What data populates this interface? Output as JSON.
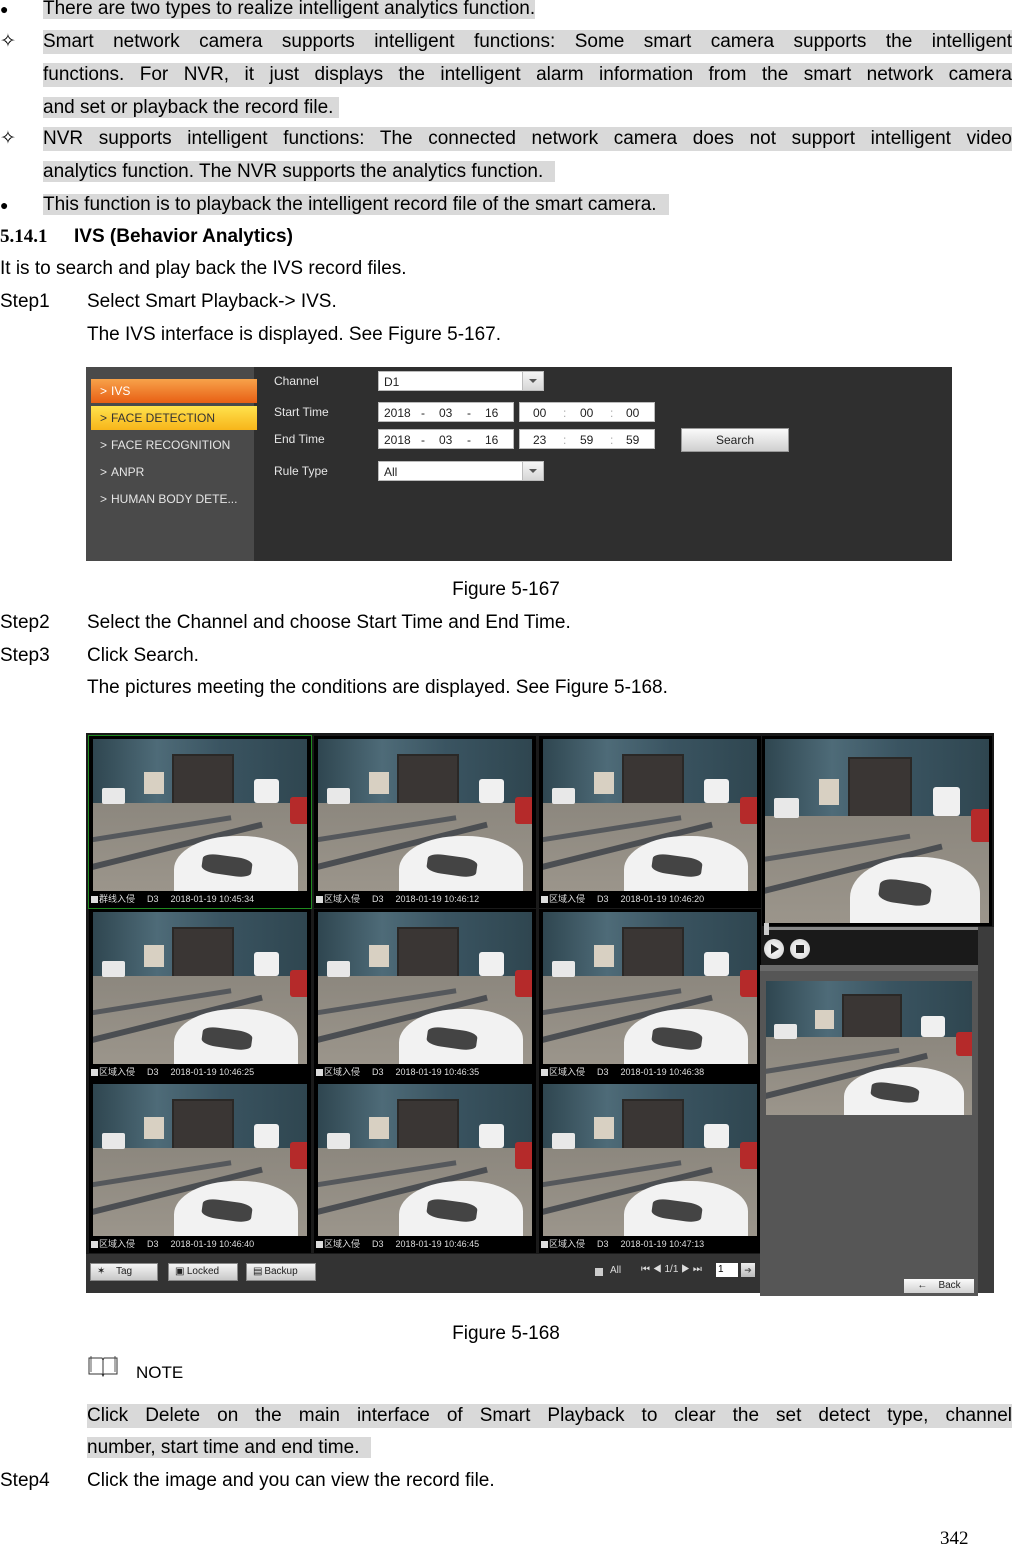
{
  "bullets": [
    {
      "icon": "filled-bullet-icon",
      "glyph": "●",
      "text": "There are two types to realize intelligent analytics function."
    },
    {
      "icon": "diamond-bullet-icon",
      "glyph": "✧",
      "lines": [
        "Smart network camera supports intelligent functions: Some smart camera supports the intelligent",
        "functions. For NVR, it just displays the intelligent alarm information from the smart network camera",
        "and set or playback the record file."
      ]
    },
    {
      "icon": "diamond-bullet-icon",
      "glyph": "✧",
      "lines": [
        "NVR supports intelligent functions: The connected network camera does not support intelligent video",
        "analytics function. The NVR supports the analytics function."
      ]
    },
    {
      "icon": "filled-bullet-icon",
      "glyph": "●",
      "text": "This function is to playback the intelligent record file of the smart camera."
    }
  ],
  "section": {
    "number": "5.14.1",
    "title": "IVS (Behavior Analytics)"
  },
  "intro": "It is to search and play back the IVS record files.",
  "steps": [
    {
      "label": "Step1",
      "text": "Select Smart Playback-> IVS.",
      "sub": "The IVS interface is displayed. See Figure 5-167."
    },
    {
      "label": "Step2",
      "text": "Select the Channel and choose Start Time and End Time."
    },
    {
      "label": "Step3",
      "text": "Click Search.",
      "sub": "The pictures meeting the conditions are displayed. See Figure 5-168."
    },
    {
      "label": "Step4",
      "text": "Click the image and you can view the record file."
    }
  ],
  "figure167": {
    "caption": "Figure 5-167",
    "menu": [
      {
        "label": "IVS",
        "state": "active"
      },
      {
        "label": "FACE DETECTION",
        "state": "selected"
      },
      {
        "label": "FACE RECOGNITION",
        "state": ""
      },
      {
        "label": "ANPR",
        "state": ""
      },
      {
        "label": "HUMAN BODY DETE...",
        "state": ""
      }
    ],
    "chevron": ">",
    "form": {
      "channel_label": "Channel",
      "channel_value": "D1",
      "start_label": "Start Time",
      "start_date": {
        "year": "2018",
        "month": "03",
        "day": "16"
      },
      "start_time": {
        "h": "00",
        "m": "00",
        "s": "00"
      },
      "end_label": "End Time",
      "end_date": {
        "year": "2018",
        "month": "03",
        "day": "16"
      },
      "end_time": {
        "h": "23",
        "m": "59",
        "s": "59"
      },
      "rule_label": "Rule Type",
      "rule_value": "All",
      "date_sep": "-",
      "time_sep": ":",
      "search_label": "Search"
    }
  },
  "figure168": {
    "caption": "Figure 5-168",
    "tiles": [
      {
        "event": "群线入侵",
        "channel": "D3",
        "time": "2018-01-19 10:45:34"
      },
      {
        "event": "区域入侵",
        "channel": "D3",
        "time": "2018-01-19 10:46:12"
      },
      {
        "event": "区域入侵",
        "channel": "D3",
        "time": "2018-01-19 10:46:20"
      },
      {
        "event": "区域入侵",
        "channel": "D3",
        "time": "2018-01-19 10:46:25"
      },
      {
        "event": "区域入侵",
        "channel": "D3",
        "time": "2018-01-19 10:46:35"
      },
      {
        "event": "区域入侵",
        "channel": "D3",
        "time": "2018-01-19 10:46:38"
      },
      {
        "event": "区域入侵",
        "channel": "D3",
        "time": "2018-01-19 10:46:40"
      },
      {
        "event": "区域入侵",
        "channel": "D3",
        "time": "2018-01-19 10:46:45"
      },
      {
        "event": "区域入侵",
        "channel": "D3",
        "time": "2018-01-19 10:47:13"
      }
    ],
    "toolbar": {
      "tag": "Tag",
      "locked": "Locked",
      "backup": "Backup",
      "all": "All",
      "page_info": "1/1",
      "page_input": "1",
      "back": "Back"
    },
    "pager_glyphs": {
      "first": "⏮",
      "prev": "◀",
      "next": "▶",
      "last": "⏭",
      "go": "➔"
    }
  },
  "note": {
    "label": "NOTE",
    "lines": [
      "Click Delete on the main interface of Smart Playback to clear the set detect type, channel",
      "number, start time and end time."
    ]
  },
  "page_number": "342"
}
